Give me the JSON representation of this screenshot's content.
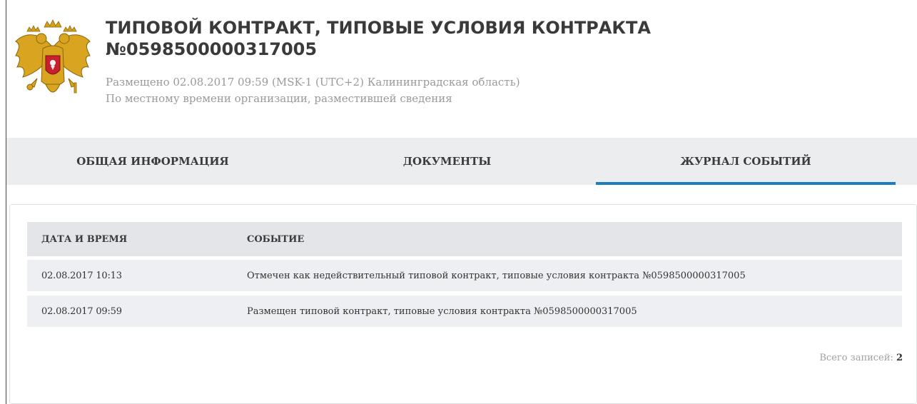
{
  "header": {
    "title_line1": "ТИПОВОЙ КОНТРАКТ, ТИПОВЫЕ УСЛОВИЯ КОНТРАКТА",
    "title_line2": "№0598500000317005",
    "published": "Размещено 02.08.2017 09:59 (MSK-1 (UTC+2) Калининградская область)",
    "timezone_note": "По местному времени организации, разместившей сведения",
    "emblem_icon": "russian-coat-of-arms-icon"
  },
  "tabs": [
    {
      "label": "ОБЩАЯ ИНФОРМАЦИЯ",
      "active": false
    },
    {
      "label": "ДОКУМЕНТЫ",
      "active": false
    },
    {
      "label": "ЖУРНАЛ СОБЫТИЙ",
      "active": true
    }
  ],
  "events_table": {
    "columns": [
      "ДАТА И ВРЕМЯ",
      "СОБЫТИЕ"
    ],
    "rows": [
      [
        "02.08.2017 10:13",
        "Отмечен как недействительный типовой контракт, типовые условия контракта №0598500000317005"
      ],
      [
        "02.08.2017 09:59",
        "Размещен типовой контракт, типовые условия контракта №0598500000317005"
      ]
    ]
  },
  "footer": {
    "total_label": "Всего записей:",
    "total_value": "2"
  },
  "colors": {
    "accent": "#1a7fc1",
    "tab_bg": "#ecedef",
    "table_header_bg": "#e3e5e9",
    "row_bg": "#eeeff2",
    "muted_text": "#9a9a9a"
  }
}
